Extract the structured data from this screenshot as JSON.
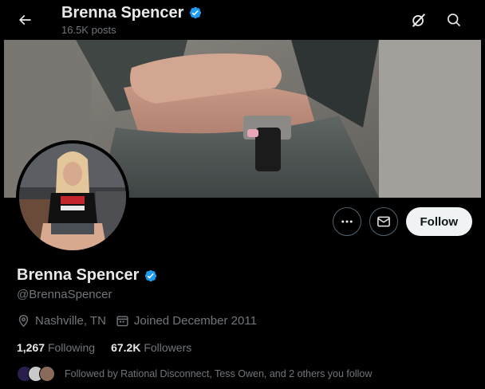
{
  "header": {
    "title": "Brenna Spencer",
    "posts_count": "16.5K posts"
  },
  "profile": {
    "display_name": "Brenna Spencer",
    "handle": "@BrennaSpencer",
    "location": "Nashville, TN",
    "joined": "Joined December 2011",
    "verified": true
  },
  "actions": {
    "follow_label": "Follow"
  },
  "stats": {
    "following_count": "1,267",
    "following_label": "Following",
    "followers_count": "67.2K",
    "followers_label": "Followers"
  },
  "followed_by": {
    "text": "Followed by Rational Disconnect, Tess Owen, and 2 others you follow"
  },
  "icons": {
    "back": "arrow-left-icon",
    "grok": "grok-icon",
    "search": "search-icon",
    "more": "more-icon",
    "message": "envelope-icon",
    "verified": "verified-badge-icon",
    "location": "location-pin-icon",
    "calendar": "calendar-icon"
  },
  "colors": {
    "background": "#000000",
    "text_primary": "#e7e9ea",
    "text_secondary": "#71767b",
    "verified_blue": "#1d9bf0",
    "follow_button_bg": "#eff3f4"
  }
}
